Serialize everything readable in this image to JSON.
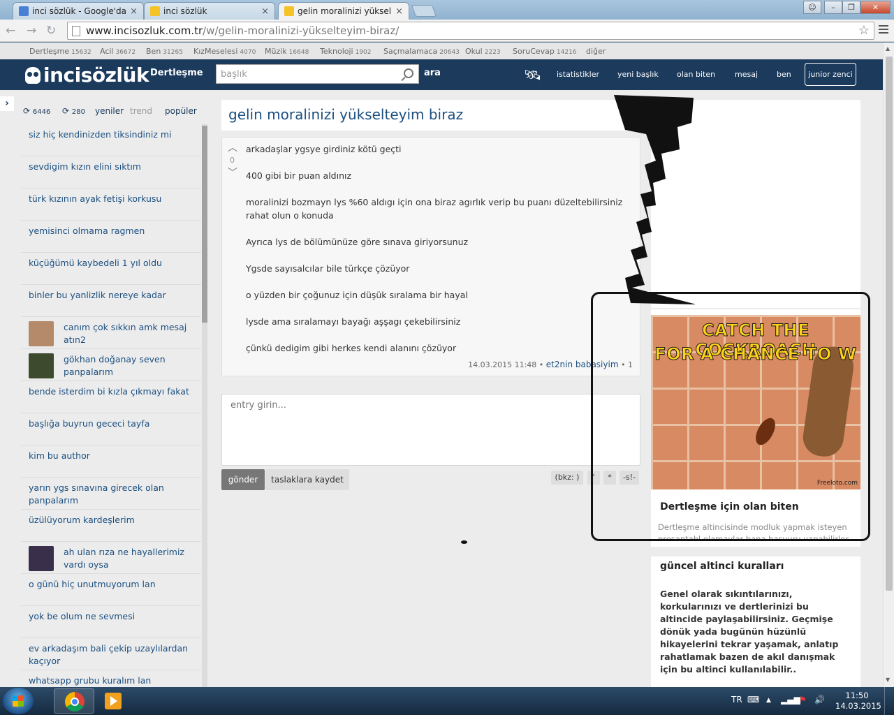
{
  "browser": {
    "tabs": [
      {
        "title": "inci sözlük - Google'da Ar",
        "active": false,
        "favicon_color": "#4a7fd6"
      },
      {
        "title": "inci sözlük",
        "active": false,
        "favicon_color": "#f5c325"
      },
      {
        "title": "gelin moralinizi yükseltey",
        "active": true,
        "favicon_color": "#f5c325"
      }
    ],
    "close_glyph": "×",
    "url_host": "www.incisozluk.com.tr",
    "url_path": "/w/gelin-moralinizi-yükselteyim-biraz/"
  },
  "categories": [
    {
      "label": "Dertleşme",
      "count": "15632"
    },
    {
      "label": "Acil",
      "count": "36672"
    },
    {
      "label": "Ben",
      "count": "31265"
    },
    {
      "label": "KızMeselesi",
      "count": "4070"
    },
    {
      "label": "Müzik",
      "count": "16648"
    },
    {
      "label": "Teknoloji",
      "count": "1902"
    },
    {
      "label": "Saçmalamaca",
      "count": "20643"
    },
    {
      "label": "Okul",
      "count": "2223"
    },
    {
      "label": "SoruCevap",
      "count": "14216"
    },
    {
      "label": "diğer",
      "count": ""
    }
  ],
  "header": {
    "logo": "incisözlük",
    "section_title": "Dertleşme",
    "search_placeholder": "başlık",
    "search_button": "ara",
    "nav": [
      "istatistikler",
      "yeni başlık",
      "olan biten",
      "mesaj",
      "ben"
    ],
    "user_button": "junior zenci"
  },
  "left": {
    "toggle_glyph": "›",
    "count1": "6446",
    "count2": "280",
    "tabs": [
      "yeniler",
      "trend",
      "popüler"
    ],
    "items": [
      {
        "title": "siz hiç kendinizden tiksindiniz mi",
        "avatar": ""
      },
      {
        "title": "sevdigim kızın elini sıktım",
        "avatar": ""
      },
      {
        "title": "türk kızının ayak fetişi korkusu",
        "avatar": ""
      },
      {
        "title": "yemisinci olmama ragmen",
        "avatar": ""
      },
      {
        "title": "küçüğümü kaybedeli 1 yıl oldu",
        "avatar": ""
      },
      {
        "title": "binler bu yanlizlik nereye kadar",
        "avatar": ""
      },
      {
        "title": "canım çok sıkkın amk mesaj atın2",
        "avatar": "#b58a6a"
      },
      {
        "title": "gökhan doğanay seven panpalarım",
        "avatar": "#3d4a2e"
      },
      {
        "title": "bende isterdim bi kızla çıkmayı fakat",
        "avatar": ""
      },
      {
        "title": "başlığa buyrun gececi tayfa",
        "avatar": ""
      },
      {
        "title": "kim bu author",
        "avatar": ""
      },
      {
        "title": "yarın ygs sınavına girecek olan panpalarım",
        "avatar": ""
      },
      {
        "title": "üzülüyorum kardeşlerim",
        "avatar": ""
      },
      {
        "title": "ah ulan rıza ne hayallerimiz vardı oysa",
        "avatar": "#3a2f4a"
      },
      {
        "title": "o günü hiç unutmuyorum lan",
        "avatar": ""
      },
      {
        "title": "yok be olum ne sevmesi",
        "avatar": ""
      },
      {
        "title": "ev arkadaşım bali çekip uzaylılardan kaçıyor",
        "avatar": ""
      },
      {
        "title": "whatsapp grubu kuralım lan",
        "avatar": ""
      }
    ]
  },
  "topic": {
    "title": "gelin moralinizi yükselteyim biraz",
    "vote_count": "0",
    "lines": [
      "arkadaşlar ygsye girdiniz kötü geçti",
      "400 gibi bir puan aldınız",
      "moralinizi bozmayn lys %60 aldıgı için ona biraz agırlık verip bu puanı düzeltebilirsiniz rahat olun o konuda",
      "Ayrıca lys de bölümünüze göre sınava giriyorsunuz",
      "Ygsde sayısalcılar bile türkçe çözüyor",
      "o yüzden bir çoğunuz için düşük sıralama bir hayal",
      "lysde ama sıralamayı bayağı aşşagı çekebilirsiniz",
      "çünkü dedigim gibi herkes kendi alanını çözüyor"
    ],
    "timestamp": "14.03.2015 11:48",
    "author": "et2nin babasiyim",
    "entry_number": "1"
  },
  "editor": {
    "placeholder": "entry girin...",
    "send": "gönder",
    "draft": "taslaklara kaydet",
    "format_buttons": [
      "(bkz: )",
      "'",
      "*",
      "-s!-"
    ]
  },
  "right": {
    "ad_lines": [
      "CATCH THE COCKROACH",
      "FOR A CHANCE TO W"
    ],
    "ad_brand": "Freeloto.com",
    "section_title": "Dertleşme için olan biten",
    "section_desc": "Dertleşme altincisinde modluk yapmak isteyen prosantabl olamaylar bana başvuru yapabilirler",
    "rules_title": "güncel altinci kuralları",
    "rules_text": "Genel olarak sıkıntılarınızı, korkularınızı ve dertlerinizi bu altincide paylaşabilirsiniz. Geçmişe dönük yada bugünün hüzünlü hikayelerini tekrar yaşamak, anlatıp rahatlamak bazen de akıl danışmak için bu altinci kullanılabilir.."
  },
  "taskbar": {
    "language": "TR",
    "time": "11:50",
    "date": "14.03.2015"
  }
}
